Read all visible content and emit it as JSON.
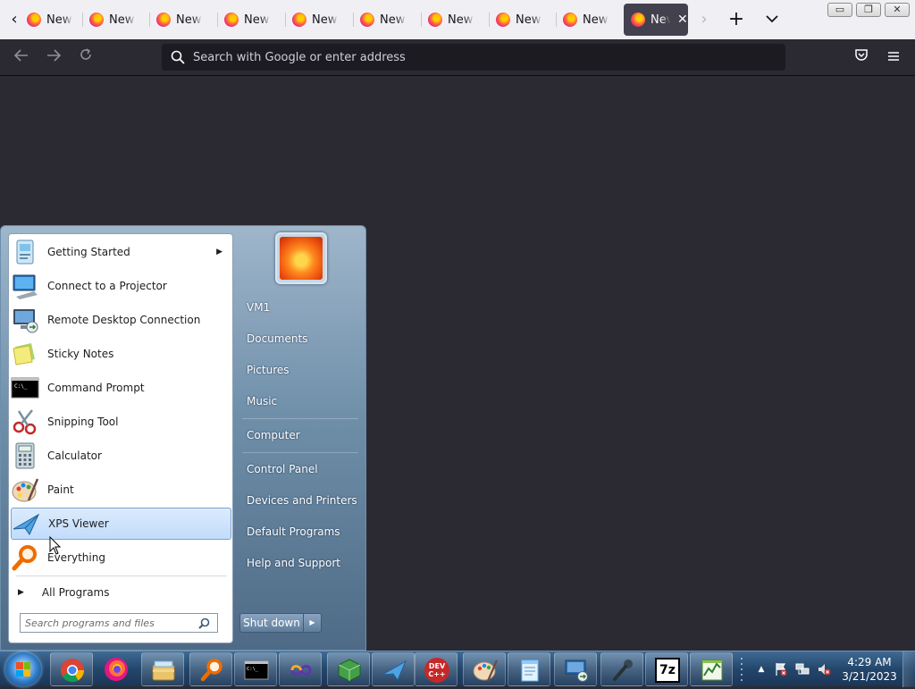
{
  "browser": {
    "tabs": [
      {
        "label": "New Tab"
      },
      {
        "label": "New Tab"
      },
      {
        "label": "New Tab"
      },
      {
        "label": "New Tab"
      },
      {
        "label": "New Tab"
      },
      {
        "label": "New Tab"
      },
      {
        "label": "New Tab"
      },
      {
        "label": "New Tab"
      },
      {
        "label": "New Tab"
      },
      {
        "label": "New Tab"
      }
    ],
    "active_tab_label": "New Tab",
    "new_tab_glyph": "+",
    "list_tabs_glyph": "⌄",
    "url_placeholder": "Search with Google or enter address",
    "window_buttons": {
      "minimize": "▭",
      "restore": "❐",
      "close": "✕"
    }
  },
  "start_menu": {
    "programs": [
      {
        "label": "Getting Started",
        "icon": "getting-started-icon",
        "submenu": true
      },
      {
        "label": "Connect to a Projector",
        "icon": "projector-icon"
      },
      {
        "label": "Remote Desktop Connection",
        "icon": "remote-desktop-icon"
      },
      {
        "label": "Sticky Notes",
        "icon": "sticky-notes-icon"
      },
      {
        "label": "Command Prompt",
        "icon": "command-prompt-icon"
      },
      {
        "label": "Snipping Tool",
        "icon": "scissors-icon"
      },
      {
        "label": "Calculator",
        "icon": "calculator-icon"
      },
      {
        "label": "Paint",
        "icon": "paint-palette-icon"
      },
      {
        "label": "XPS Viewer",
        "icon": "xps-viewer-icon",
        "highlighted": true
      },
      {
        "label": "Everything",
        "icon": "magnifier-icon"
      }
    ],
    "all_programs": "All Programs",
    "search_placeholder": "Search programs and files",
    "right_links": [
      {
        "label": "VM1"
      },
      {
        "label": "Documents"
      },
      {
        "label": "Pictures"
      },
      {
        "label": "Music"
      },
      {
        "label": "Computer"
      },
      {
        "label": "Control Panel"
      },
      {
        "label": "Devices and Printers"
      },
      {
        "label": "Default Programs"
      },
      {
        "label": "Help and Support"
      }
    ],
    "shutdown_label": "Shut down"
  },
  "taskbar": {
    "pinned": [
      "chrome-icon",
      "firefox-icon",
      "file-explorer-icon",
      "everything-search-icon",
      "command-prompt-icon",
      "infinity-app-icon",
      "cube-app-icon",
      "xps-viewer-icon",
      "dev-cpp-icon",
      "paint-icon",
      "notepad-icon",
      "remote-desktop-icon",
      "microphone-icon",
      "7zip-icon",
      "monitor-app-icon"
    ],
    "dev_cpp_text": "DEV C++",
    "sevenzip_text": "7z",
    "clock_time": "4:29 AM",
    "clock_date": "3/21/2023"
  },
  "colors": {
    "browser_bg": "#2b2a33",
    "tab_strip": "#f0f0f4",
    "taskbar_blue": "#24466b",
    "highlight": "#c1dcfc"
  }
}
